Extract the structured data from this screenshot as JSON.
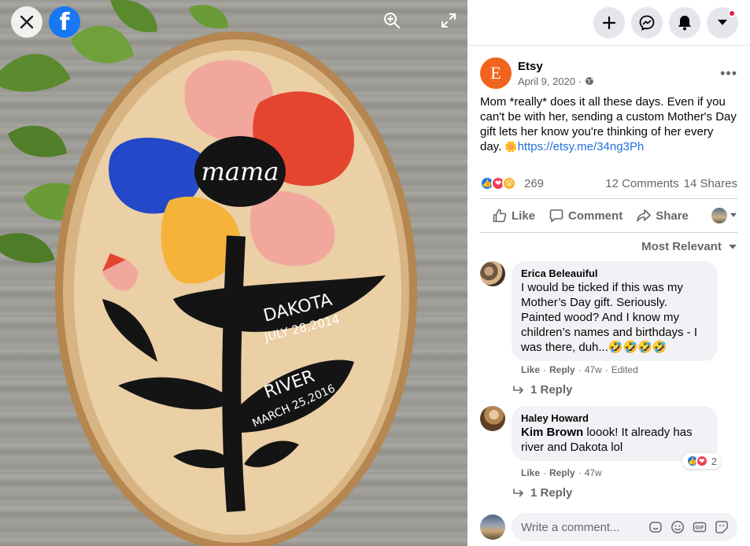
{
  "viewer": {
    "close_icon": "close-icon",
    "logo_icon": "facebook-logo-icon",
    "logo_letter": "f",
    "zoom_icon": "zoom-in-icon",
    "fullscreen_icon": "fullscreen-icon",
    "photo": {
      "texts": {
        "center": "mama",
        "name1": "DAKOTA",
        "date1": "JULY 28,2014",
        "name2": "RIVER",
        "date2": "MARCH 25,2016"
      }
    }
  },
  "topbar": {
    "buttons": [
      "create-icon",
      "messenger-icon",
      "notifications-icon",
      "account-menu-icon"
    ]
  },
  "post": {
    "page_initial": "E",
    "page_name": "Etsy",
    "date": "April 9, 2020",
    "separator": "·",
    "privacy_icon": "globe-icon",
    "more_label": "•••",
    "text": "Mom *really* does it all these days. Even if you can't be with her, sending a custom Mother's Day gift lets her know you're thinking of her every day. ",
    "emoji": "🌼",
    "link": "https://etsy.me/34ng3Ph"
  },
  "stats": {
    "reactions": [
      "like",
      "love",
      "wow"
    ],
    "reaction_count": "269",
    "comments": "12 Comments",
    "shares": "14 Shares"
  },
  "actions": {
    "like": "Like",
    "comment": "Comment",
    "share": "Share"
  },
  "comments_sort": "Most Relevant",
  "comments": [
    {
      "name": "Erica Beleauiful",
      "text": "I would be ticked if this was my Mother’s Day gift. Seriously. Painted wood? And I know my children’s names and birthdays - I was there, duh...🤣🤣🤣🤣",
      "like": "Like",
      "reply": "Reply",
      "time": "47w",
      "edited": "Edited",
      "replies": "1 Reply"
    },
    {
      "name": "Haley Howard",
      "mention": "Kim Brown",
      "text": " loook! It already has river and Dakota lol",
      "like": "Like",
      "reply": "Reply",
      "time": "47w",
      "reaction_count": "2",
      "replies": "1 Reply"
    }
  ],
  "composer": {
    "placeholder": "Write a comment...",
    "icons": [
      "sticker-icon",
      "emoji-icon",
      "gif-icon",
      "sticker-pack-icon"
    ]
  },
  "colors": {
    "facebook_blue": "#1877f2",
    "etsy_orange": "#f1641e",
    "link_blue": "#216fdb",
    "love_red": "#f33e58",
    "wow_yellow": "#f7b125",
    "secondary_text": "#65676b"
  }
}
